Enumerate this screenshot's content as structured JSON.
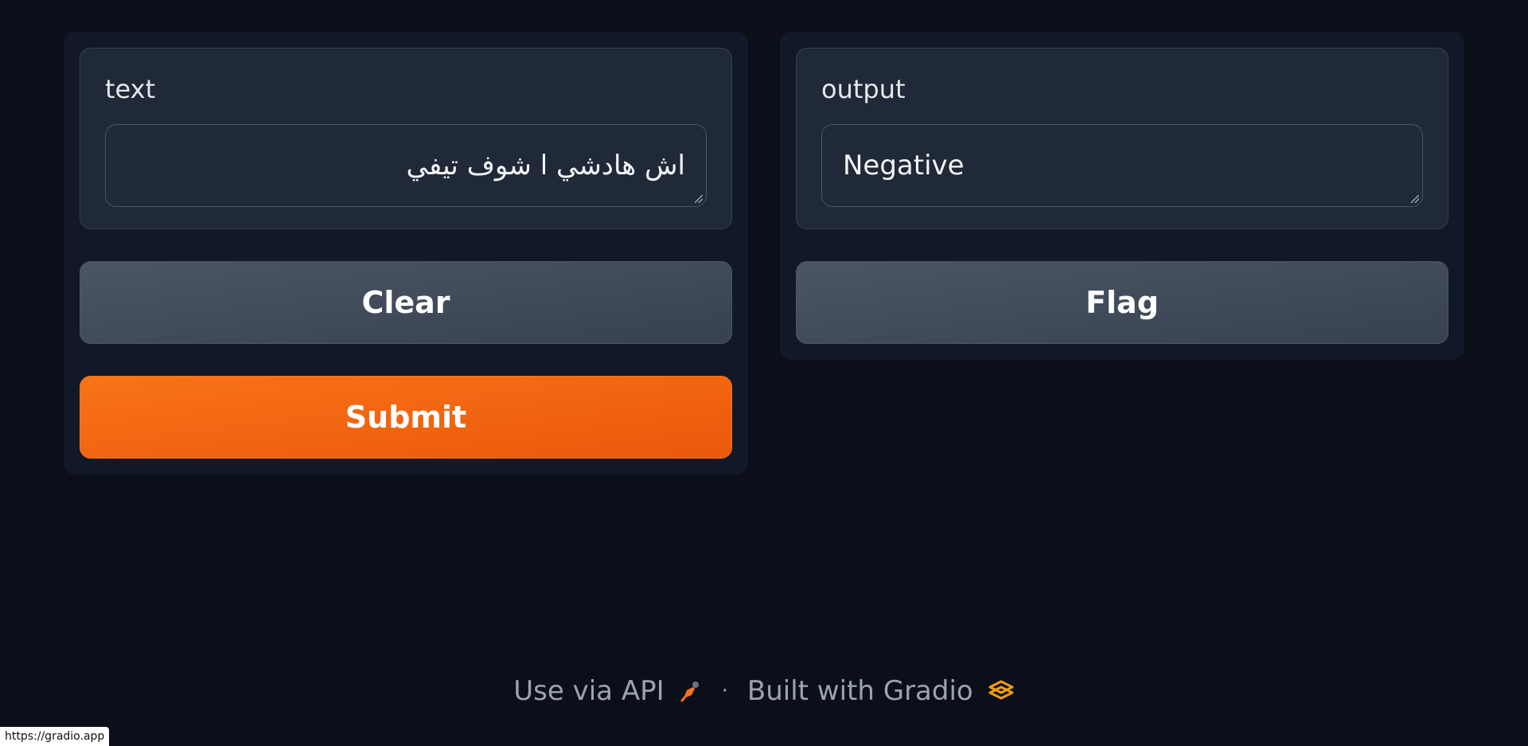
{
  "input_panel": {
    "label": "text",
    "value": "اش هادشي ا شوف تيفي",
    "clear_label": "Clear",
    "submit_label": "Submit"
  },
  "output_panel": {
    "label": "output",
    "value": "Negative",
    "flag_label": "Flag"
  },
  "footer": {
    "api_label": "Use via API",
    "api_icon": "rocket-icon",
    "separator": "·",
    "built_label": "Built with Gradio",
    "gradio_icon": "gradio-logo-icon"
  },
  "status_bar": {
    "url": "https://gradio.app"
  },
  "colors": {
    "background": "#0b0f19",
    "panel": "#111827",
    "block": "#1f2937",
    "primary": "#f97316",
    "secondary": "#4b5563"
  }
}
